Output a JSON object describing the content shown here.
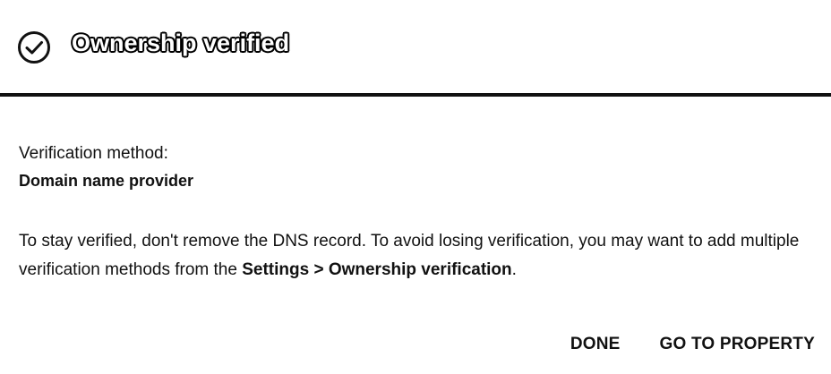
{
  "header": {
    "icon": "check-circle-icon",
    "title": "Ownership verified"
  },
  "method": {
    "label": "Verification method:",
    "value": "Domain name provider"
  },
  "info": {
    "text_before": "To stay verified, don't remove the DNS record. To avoid losing verification, you may want to add multiple verification methods from the ",
    "link_text": "Settings > Ownership verification",
    "text_after": "."
  },
  "actions": {
    "done_label": "DONE",
    "go_to_property_label": "GO TO PROPERTY"
  },
  "colors": {
    "text": "#111111",
    "background": "#ffffff",
    "divider": "#111111"
  }
}
